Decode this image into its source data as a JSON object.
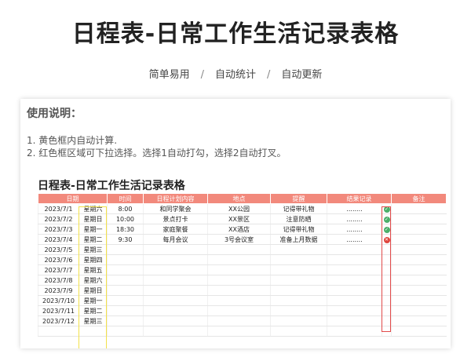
{
  "page": {
    "title": "日程表-日常工作生活记录表格",
    "subtitle": [
      "简单易用",
      "自动统计",
      "自动更新"
    ],
    "separator": "/"
  },
  "usage": {
    "title": "使用说明：",
    "lines": [
      "1. 黄色框内自动计算.",
      "2. 红色框区域可下拉选择。选择1自动打勾，选择2自动打叉。"
    ]
  },
  "table": {
    "title": "日程表-日常工作生活记录表格",
    "headers": [
      "日期",
      "",
      "时间",
      "日程计划内容",
      "地点",
      "提醒",
      "结果记录",
      "",
      "备注"
    ],
    "rows": [
      {
        "date": "2023/7/1",
        "weekday": "星期六",
        "time": "8:00",
        "plan": "和同学聚会",
        "place": "XX公园",
        "reminder": "记得带礼物",
        "result": "........",
        "mark": "ok",
        "note": ""
      },
      {
        "date": "2023/7/2",
        "weekday": "星期日",
        "time": "10:00",
        "plan": "景点打卡",
        "place": "XX景区",
        "reminder": "注意防晒",
        "result": "........",
        "mark": "ok",
        "note": ""
      },
      {
        "date": "2023/7/3",
        "weekday": "星期一",
        "time": "18:30",
        "plan": "家庭聚餐",
        "place": "XX酒店",
        "reminder": "记得带礼物",
        "result": "........",
        "mark": "ok",
        "note": ""
      },
      {
        "date": "2023/7/4",
        "weekday": "星期二",
        "time": "9:30",
        "plan": "每月会议",
        "place": "3号会议室",
        "reminder": "准备上月数据",
        "result": "........",
        "mark": "no",
        "note": ""
      },
      {
        "date": "2023/7/5",
        "weekday": "星期三",
        "time": "",
        "plan": "",
        "place": "",
        "reminder": "",
        "result": "",
        "mark": "",
        "note": ""
      },
      {
        "date": "2023/7/6",
        "weekday": "星期四",
        "time": "",
        "plan": "",
        "place": "",
        "reminder": "",
        "result": "",
        "mark": "",
        "note": ""
      },
      {
        "date": "2023/7/7",
        "weekday": "星期五",
        "time": "",
        "plan": "",
        "place": "",
        "reminder": "",
        "result": "",
        "mark": "",
        "note": ""
      },
      {
        "date": "2023/7/8",
        "weekday": "星期六",
        "time": "",
        "plan": "",
        "place": "",
        "reminder": "",
        "result": "",
        "mark": "",
        "note": ""
      },
      {
        "date": "2023/7/9",
        "weekday": "星期日",
        "time": "",
        "plan": "",
        "place": "",
        "reminder": "",
        "result": "",
        "mark": "",
        "note": ""
      },
      {
        "date": "2023/7/10",
        "weekday": "星期一",
        "time": "",
        "plan": "",
        "place": "",
        "reminder": "",
        "result": "",
        "mark": "",
        "note": ""
      },
      {
        "date": "2023/7/11",
        "weekday": "星期二",
        "time": "",
        "plan": "",
        "place": "",
        "reminder": "",
        "result": "",
        "mark": "",
        "note": ""
      },
      {
        "date": "2023/7/12",
        "weekday": "星期三",
        "time": "",
        "plan": "",
        "place": "",
        "reminder": "",
        "result": "",
        "mark": "",
        "note": ""
      },
      {
        "date": "",
        "weekday": "",
        "time": "",
        "plan": "",
        "place": "",
        "reminder": "",
        "result": "",
        "mark": "",
        "note": ""
      }
    ]
  },
  "icons": {
    "ok": "check-circle-icon",
    "no": "cross-circle-icon"
  },
  "colors": {
    "header": "#f2897c",
    "auto_box": "#f3e14a",
    "dropdown_box": "#e24a4a",
    "ok": "#4caf6a",
    "no": "#e0453c"
  }
}
